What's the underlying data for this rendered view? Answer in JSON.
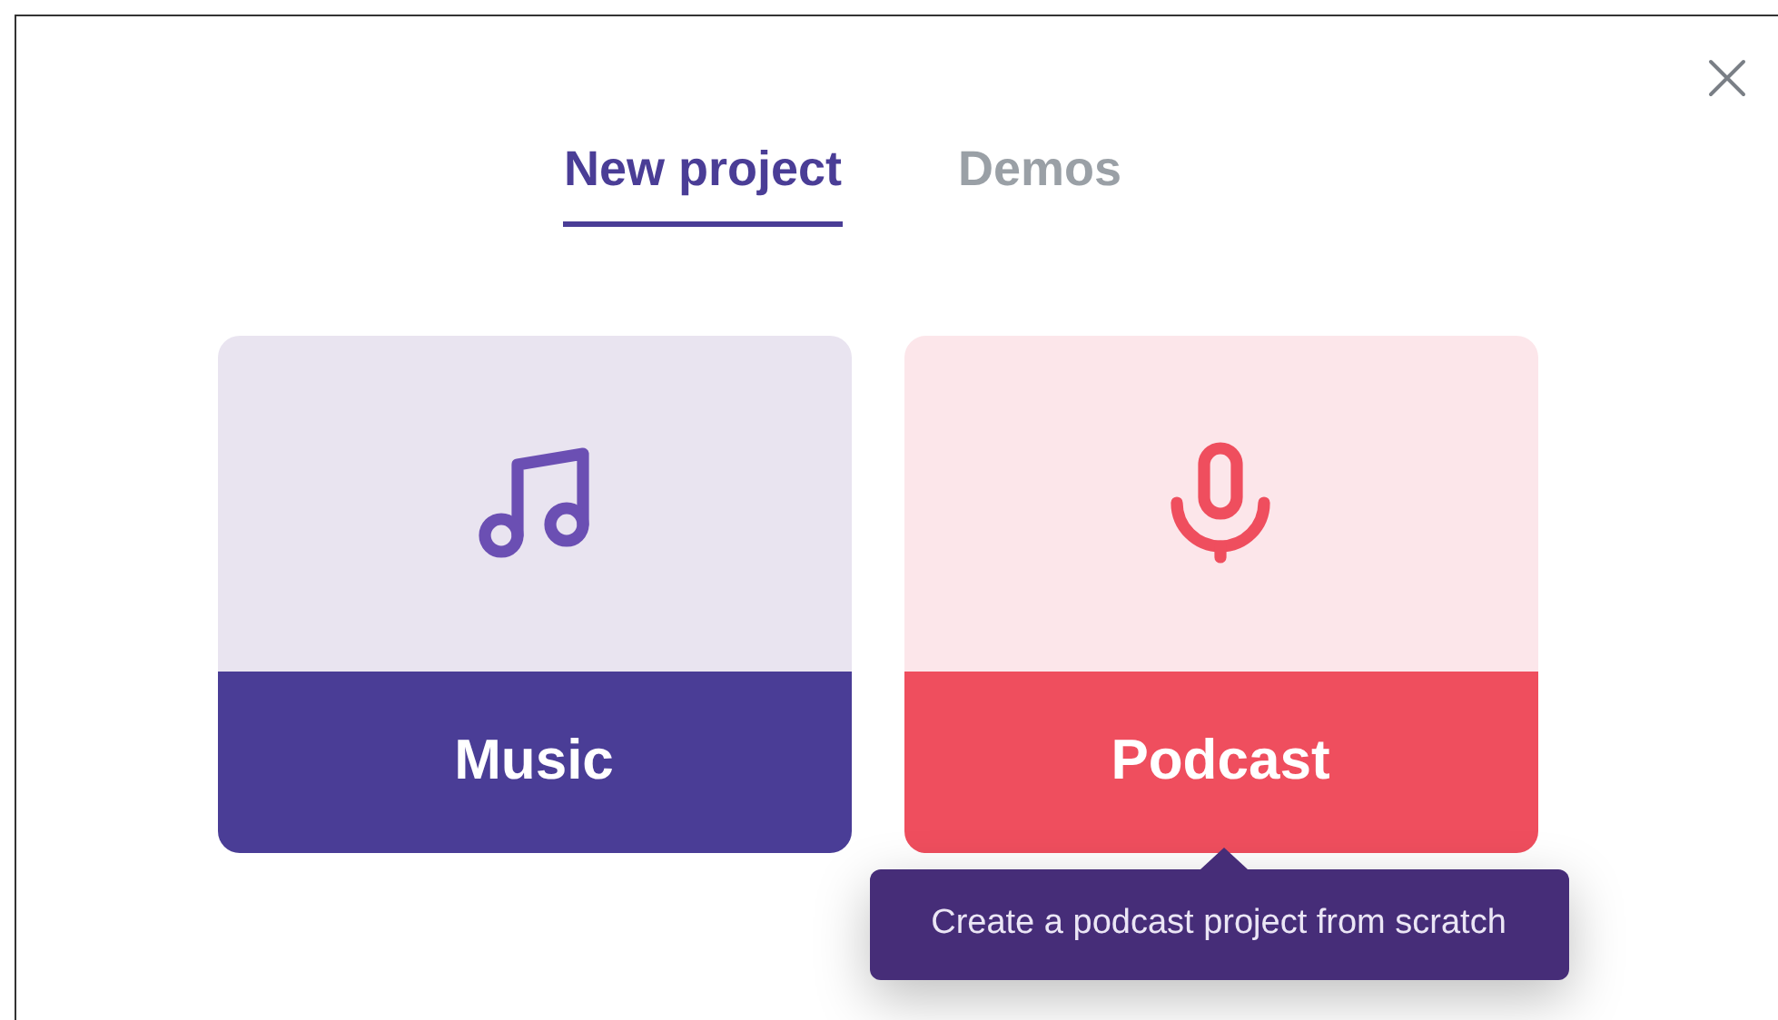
{
  "tabs": [
    {
      "label": "New project",
      "selected": true
    },
    {
      "label": "Demos",
      "selected": false
    }
  ],
  "cards": [
    {
      "kind": "music",
      "label": "Music"
    },
    {
      "kind": "podcast",
      "label": "Podcast",
      "tooltip": "Create a podcast project from scratch"
    }
  ]
}
